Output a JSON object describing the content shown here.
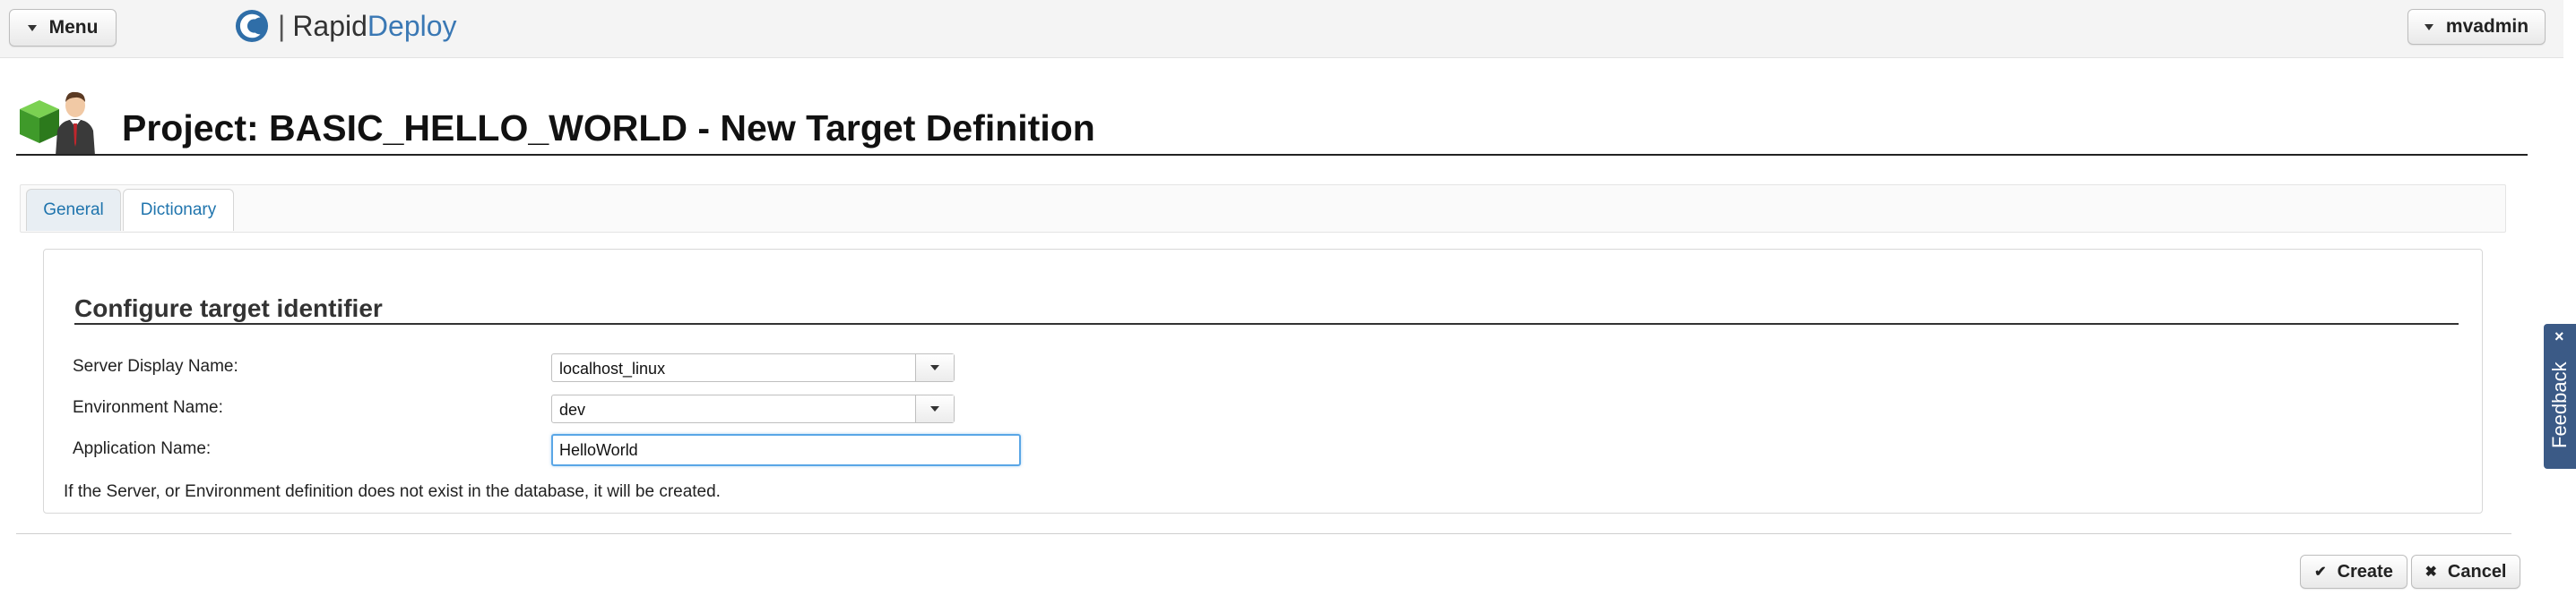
{
  "topbar": {
    "menu_label": "Menu",
    "brand_rapid": "Rapid",
    "brand_deploy": "Deploy",
    "brand_separator": "|",
    "user_label": "mvadmin"
  },
  "header": {
    "title": "Project: BASIC_HELLO_WORLD - New Target Definition"
  },
  "tabs": [
    {
      "label": "General",
      "active": true
    },
    {
      "label": "Dictionary",
      "active": false
    }
  ],
  "form": {
    "section_title": "Configure target identifier",
    "fields": [
      {
        "label": "Server Display Name:",
        "value": "localhost_linux"
      },
      {
        "label": "Environment Name:",
        "value": "dev"
      },
      {
        "label": "Application Name:",
        "value": "HelloWorld"
      }
    ],
    "help_text": "If the Server, or Environment definition does not exist in the database, it will be created."
  },
  "actions": {
    "create_label": "Create",
    "cancel_label": "Cancel"
  },
  "feedback": {
    "label": "Feedback",
    "close_glyph": "×"
  },
  "colors": {
    "accent": "#3a78b4",
    "tab_link": "#1f74ad",
    "feedback_bg": "#3b5a86",
    "focus_border": "#5aa6e6"
  }
}
